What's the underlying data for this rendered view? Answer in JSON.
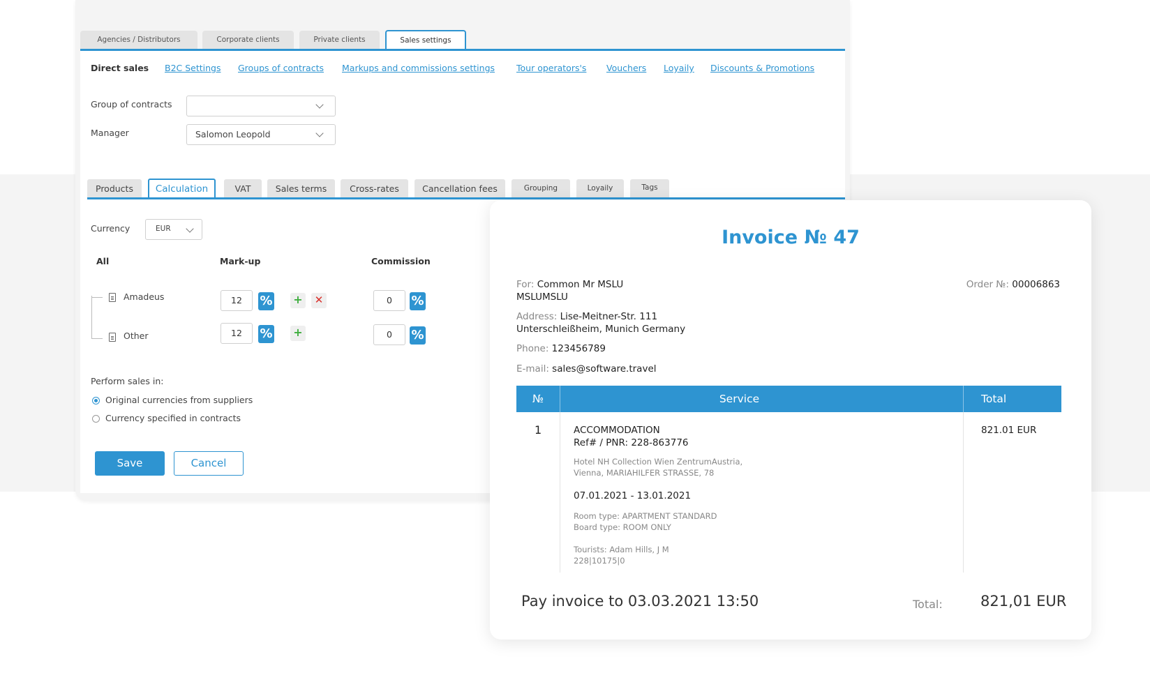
{
  "top_tabs": [
    "Agencies / Distributors",
    "Corporate clients",
    "Private clients",
    "Sales settings"
  ],
  "subnav": {
    "current": "Direct sales",
    "links": [
      "B2C Settings",
      "Groups of contracts",
      "Markups and commissions settings",
      "Tour operators's",
      "Vouchers",
      "Loyaily",
      "Discounts & Promotions"
    ]
  },
  "form": {
    "group_label": "Group of contracts",
    "group_value": "",
    "manager_label": "Manager",
    "manager_value": "Salomon Leopold"
  },
  "mid_tabs": [
    "Products",
    "Calculation",
    "VAT",
    "Sales terms",
    "Cross-rates",
    "Cancellation fees",
    "Grouping",
    "Loyaily",
    "Tags"
  ],
  "calculation": {
    "currency_label": "Currency",
    "currency_value": "EUR",
    "col_all": "All",
    "col_markup": "Mark-up",
    "col_commission": "Commission",
    "rows": [
      {
        "name": "Amadeus",
        "markup": "12",
        "commission": "0"
      },
      {
        "name": "Other",
        "markup": "12",
        "commission": "0"
      }
    ],
    "percent_symbol": "%",
    "plus_symbol": "+",
    "delete_symbol": "✕",
    "perform_label": "Perform sales in:",
    "radio_options": [
      "Original currencies from suppliers",
      "Currency specified in contracts"
    ],
    "selected_radio": 0,
    "save_label": "Save",
    "cancel_label": "Cancel"
  },
  "invoice": {
    "title": "Invoice № 47",
    "for_label": "For:",
    "for_name": "Common Mr MSLU",
    "for_name2": "MSLUMSLU",
    "order_label": "Order №:",
    "order_value": "00006863",
    "address_label": "Address:",
    "address_line1": "Lise-Meitner-Str. 111",
    "address_line2": "Unterschleißheim, Munich Germany",
    "phone_label": "Phone:",
    "phone_value": "123456789",
    "email_label": "E-mail:",
    "email_value": "sales@software.travel",
    "table_headers": [
      "№",
      "Service",
      "Total"
    ],
    "row": {
      "num": "1",
      "service": "ACCOMMODATION",
      "ref": "Ref# / PNR: 228-863776",
      "hotel_line1": "Hotel NH Collection Wien ZentrumAustria,",
      "hotel_line2": "Vienna, MARIAHILFER STRASSE, 78",
      "dates": "07.01.2021 - 13.01.2021",
      "room_type": "Room type: APARTMENT STANDARD",
      "board_type": "Board type: ROOM ONLY",
      "tourists": "Tourists: Adam Hills, J M",
      "code": "228|10175|0",
      "total": "821.01 EUR"
    },
    "pay_line": "Pay invoice to 03.03.2021 13:50",
    "total_label": "Total:",
    "total_value": "821,01 EUR"
  },
  "colors": {
    "accent": "#2e94d1",
    "plus": "#3fae3f",
    "delete": "#d9302b"
  }
}
